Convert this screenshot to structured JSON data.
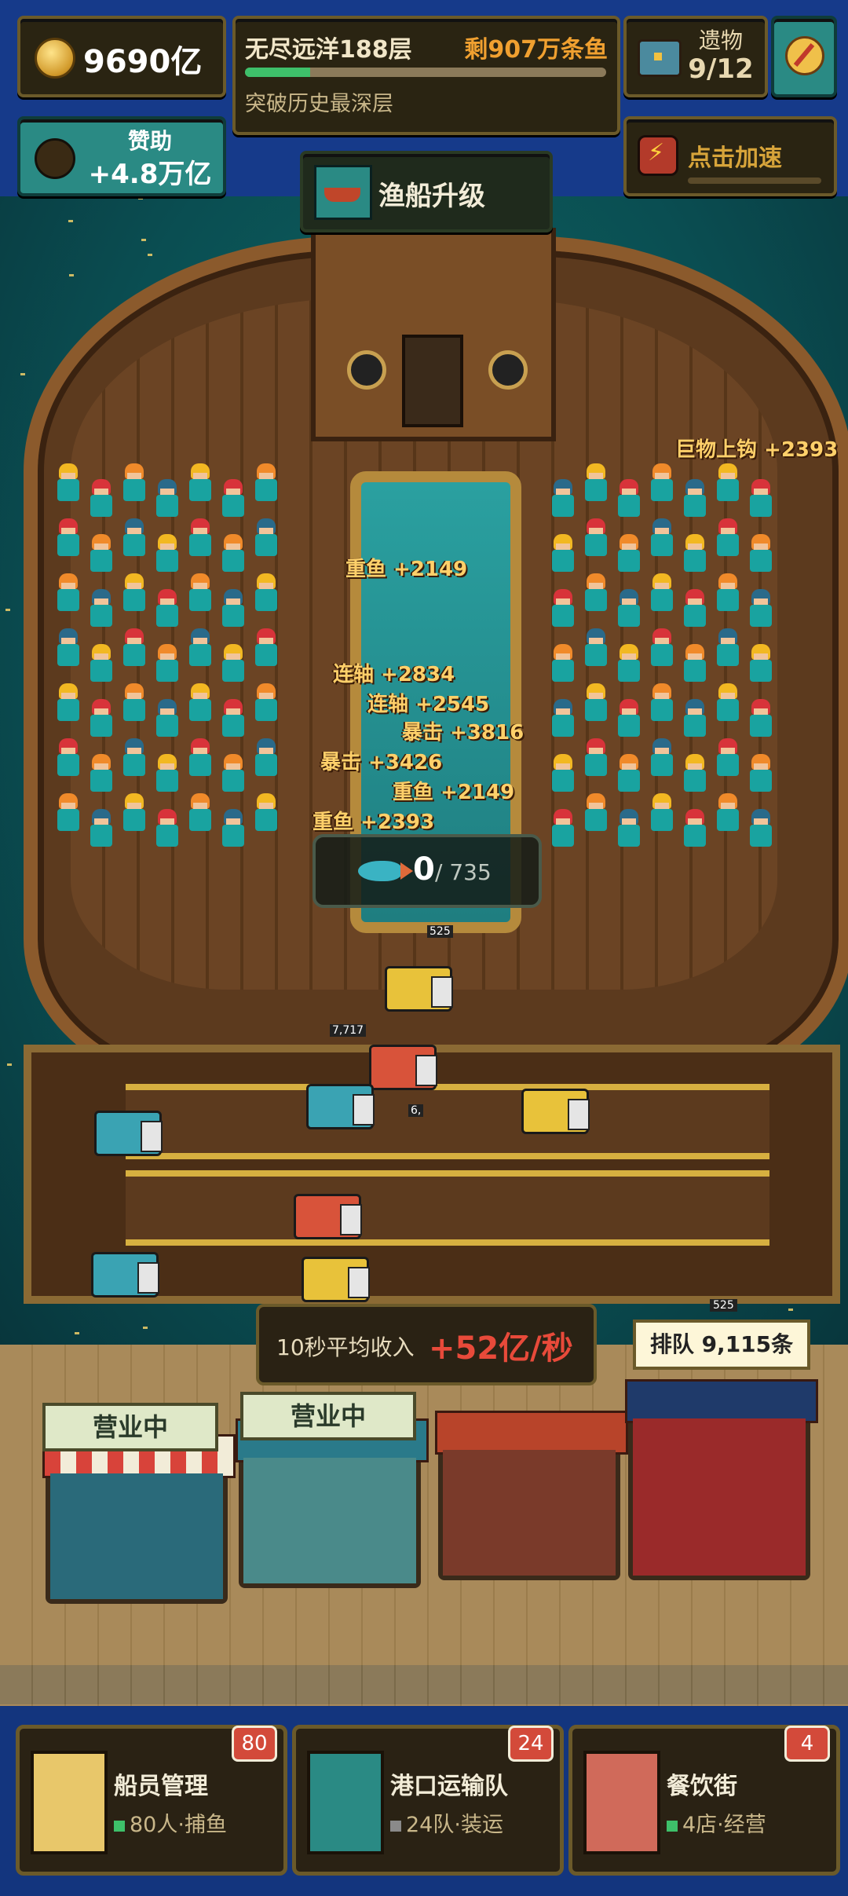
{
  "hud": {
    "coins": "9690亿",
    "sponsor_title": "赞助",
    "sponsor_value": "+4.8万亿",
    "ocean_title": "无尽远洋188层",
    "ocean_remaining": "剩907万条鱼",
    "ocean_progress": 0.18,
    "ocean_subtitle": "突破历史最深层",
    "relics_title": "遗物",
    "relics_count": "9/12",
    "boost_label": "点击加速",
    "upgrade_label": "渔船升级"
  },
  "floaters": [
    "巨物上钩 +2393",
    "重鱼 +2149",
    "连轴 +2834",
    "连轴 +2545",
    "暴击 +3816",
    "暴击 +3426",
    "重鱼 +2149",
    "重鱼 +2393"
  ],
  "fish_counter": {
    "current": "0",
    "capacity": "735"
  },
  "dock_tags": [
    "7,717",
    "525",
    "6,"
  ],
  "income": {
    "label": "10秒平均收入",
    "value": "+52亿/秒"
  },
  "shops": {
    "open1": "营业中",
    "open2": "营业中",
    "queue": "排队 9,115条",
    "queue_tag": "525"
  },
  "nav": [
    {
      "name": "船员管理",
      "sub": "80人·捕鱼",
      "badge": "80",
      "color": "#e8c76a",
      "icon": "crew-icon"
    },
    {
      "name": "港口运输队",
      "sub": "24队·装运",
      "badge": "24",
      "color": "#2a8a84",
      "icon": "truck-icon"
    },
    {
      "name": "餐饮街",
      "sub": "4店·经营",
      "badge": "4",
      "color": "#d06a5a",
      "icon": "restaurant-icon"
    }
  ],
  "colors": {
    "accent": "#ffd06a",
    "income": "#e84a3a",
    "bar_fill": "#3ec06a",
    "sea": "#0a4e52"
  }
}
